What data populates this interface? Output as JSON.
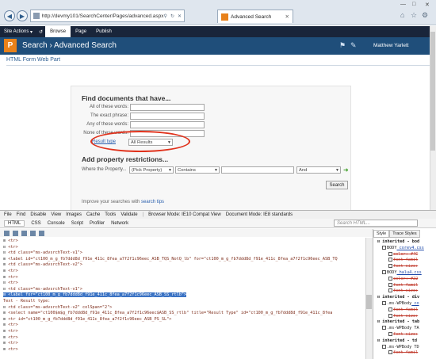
{
  "browser": {
    "url": "http://devmy101/SearchCenter/Pages/advanced.aspx",
    "tab_title": "Advanced Search"
  },
  "ribbon": {
    "site_actions": "Site Actions",
    "tabs": [
      "Browse",
      "Page",
      "Publish"
    ]
  },
  "header": {
    "breadcrumb": "Search › Advanced Search",
    "user": "Matthew Yarlett"
  },
  "webpart": {
    "title": "HTML Form Web Part"
  },
  "form": {
    "heading": "Find documents that have...",
    "fields": [
      {
        "label": "All of these words:"
      },
      {
        "label": "The exact phrase:"
      },
      {
        "label": "Any of these words:"
      },
      {
        "label": "None of these words:"
      }
    ],
    "result_type_label": "Result type",
    "result_type_value": "All Results",
    "property_heading": "Add property restrictions...",
    "where_label": "Where the Property...",
    "property_select": "(Pick Property)",
    "operator_select": "Contains",
    "conjunction_select": "And",
    "search_button": "Search",
    "hint_prefix": "Improve your searches with",
    "hint_link": "search tips",
    "accent_color": "#e0321c"
  },
  "devtools": {
    "menu": [
      "File",
      "Find",
      "Disable",
      "View",
      "Images",
      "Cache",
      "Tools",
      "Validate",
      "|",
      "Browser Mode: IE10 Compat View",
      "Document Mode: IE8 standards"
    ],
    "tabs": [
      "HTML",
      "CSS",
      "Console",
      "Script",
      "Profiler",
      "Network"
    ],
    "search_placeholder": "Search HTML...",
    "side_tabs": [
      "Style",
      "Trace Styles"
    ],
    "code_lines": [
      {
        "pm": "⊞",
        "text": "<tr>"
      },
      {
        "pm": "⊟",
        "text": "<tr>"
      },
      {
        "pm": "⊟",
        "text": "  <td class=\"ms-advsrchText-v1\">"
      },
      {
        "pm": "⊞",
        "text": "    <label id=\"ct100_m_g_fb7ddd8d_f91e_411c_8fea_a7f2f1c96eec_ASB_TQS_NotQ_lb\" for=\"ct100_m_g_fb7ddd8d_f91e_411c_8fea_a7f2f1c96eec_ASB_TQ"
      },
      {
        "pm": "⊞",
        "text": "  <td class=\"ms-advsrchText-v2\">"
      },
      {
        "pm": "⊞",
        "text": "<tr>"
      },
      {
        "pm": "⊞",
        "text": "<tr>"
      },
      {
        "pm": "⊟",
        "text": "<tr>"
      },
      {
        "pm": "⊟",
        "text": "  <td class=\"ms-advsrchText-v1\">"
      },
      {
        "pm": "⊟",
        "text": "    <label for=\"ct100_m_g_fb7ddd8d_f91e_411c_8fea_a7f2f1c96eec_ASB_SS_rtlb\">",
        "hl": true
      },
      {
        "pm": "",
        "text": "        Text - Result type:"
      },
      {
        "pm": "⊟",
        "text": "  <td class=\"ms-advsrchText-v2\" colSpan=\"2\">"
      },
      {
        "pm": "⊞",
        "text": "    <select name=\"ct100$m$g_fb7ddd8d_f91e_411c_8fea_a7f2f1c96eec$ASB_SS_rtlb\" title=\"Result Type\" id=\"ct100_m_g_fb7ddd8d_f91e_411c_8fea"
      },
      {
        "pm": "⊞",
        "text": "<tr id=\"ct100_m_g_fb7ddd8d_f91e_411c_8fea_a7f2f1c96eec_ASB_PS_SL\">"
      },
      {
        "pm": "⊞",
        "text": "<tr>"
      },
      {
        "pm": "⊞",
        "text": "<tr>"
      },
      {
        "pm": "⊞",
        "text": "<tr>"
      },
      {
        "pm": "⊞",
        "text": "<tr>"
      },
      {
        "pm": "⊞",
        "text": "<tr>"
      }
    ],
    "style_lines": [
      {
        "type": "head",
        "text": "inherited - bod"
      },
      {
        "type": "sel",
        "text": "BODY",
        "link": "corev4.css"
      },
      {
        "type": "prop",
        "text": "color: #4C"
      },
      {
        "type": "prop",
        "text": "font-famil"
      },
      {
        "type": "prop",
        "text": "font-size:"
      },
      {
        "type": "sel",
        "text": "BODY",
        "link": "halu4.css"
      },
      {
        "type": "prop",
        "text": "color: #22"
      },
      {
        "type": "prop",
        "text": "font-famil"
      },
      {
        "type": "prop",
        "text": "font-size:"
      },
      {
        "type": "head",
        "text": "inherited - div"
      },
      {
        "type": "sel",
        "text": ".ms-WPBody",
        "link": "co"
      },
      {
        "type": "prop",
        "text": "font-famil"
      },
      {
        "type": "prop",
        "text": "font-size:"
      },
      {
        "type": "head",
        "text": "inherited - tab"
      },
      {
        "type": "sel",
        "text": ".ms-WPBody TA"
      },
      {
        "type": "prop",
        "text": "font-size:"
      },
      {
        "type": "head",
        "text": "inherited - td"
      },
      {
        "type": "sel",
        "text": ".ms-WPBody TD"
      },
      {
        "type": "prop",
        "text": "font-famil"
      }
    ]
  }
}
